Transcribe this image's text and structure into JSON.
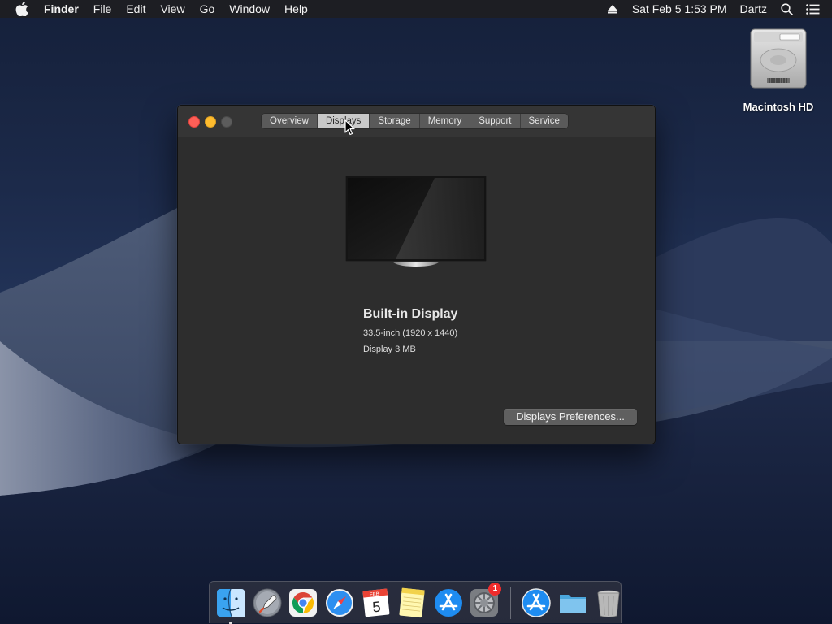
{
  "menubar": {
    "app_name": "Finder",
    "menus": [
      "File",
      "Edit",
      "View",
      "Go",
      "Window",
      "Help"
    ],
    "datetime": "Sat Feb 5  1:53 PM",
    "user": "Dartz"
  },
  "desktop": {
    "disk_label": "Macintosh HD"
  },
  "window": {
    "tabs": [
      "Overview",
      "Displays",
      "Storage",
      "Memory",
      "Support",
      "Service"
    ],
    "active_tab": "Displays",
    "display": {
      "name": "Built-in Display",
      "resolution": "33.5-inch (1920 x 1440)",
      "memory": "Display 3 MB"
    },
    "preferences_button": "Displays Preferences..."
  },
  "dock": {
    "calendar_month": "FEB",
    "calendar_day": "5",
    "system_prefs_badge": "1",
    "items": [
      "Finder",
      "Launchpad",
      "Google Chrome",
      "Safari",
      "Calendar",
      "Notes",
      "App Store",
      "System Preferences",
      "App Store",
      "Downloads",
      "Trash"
    ]
  }
}
